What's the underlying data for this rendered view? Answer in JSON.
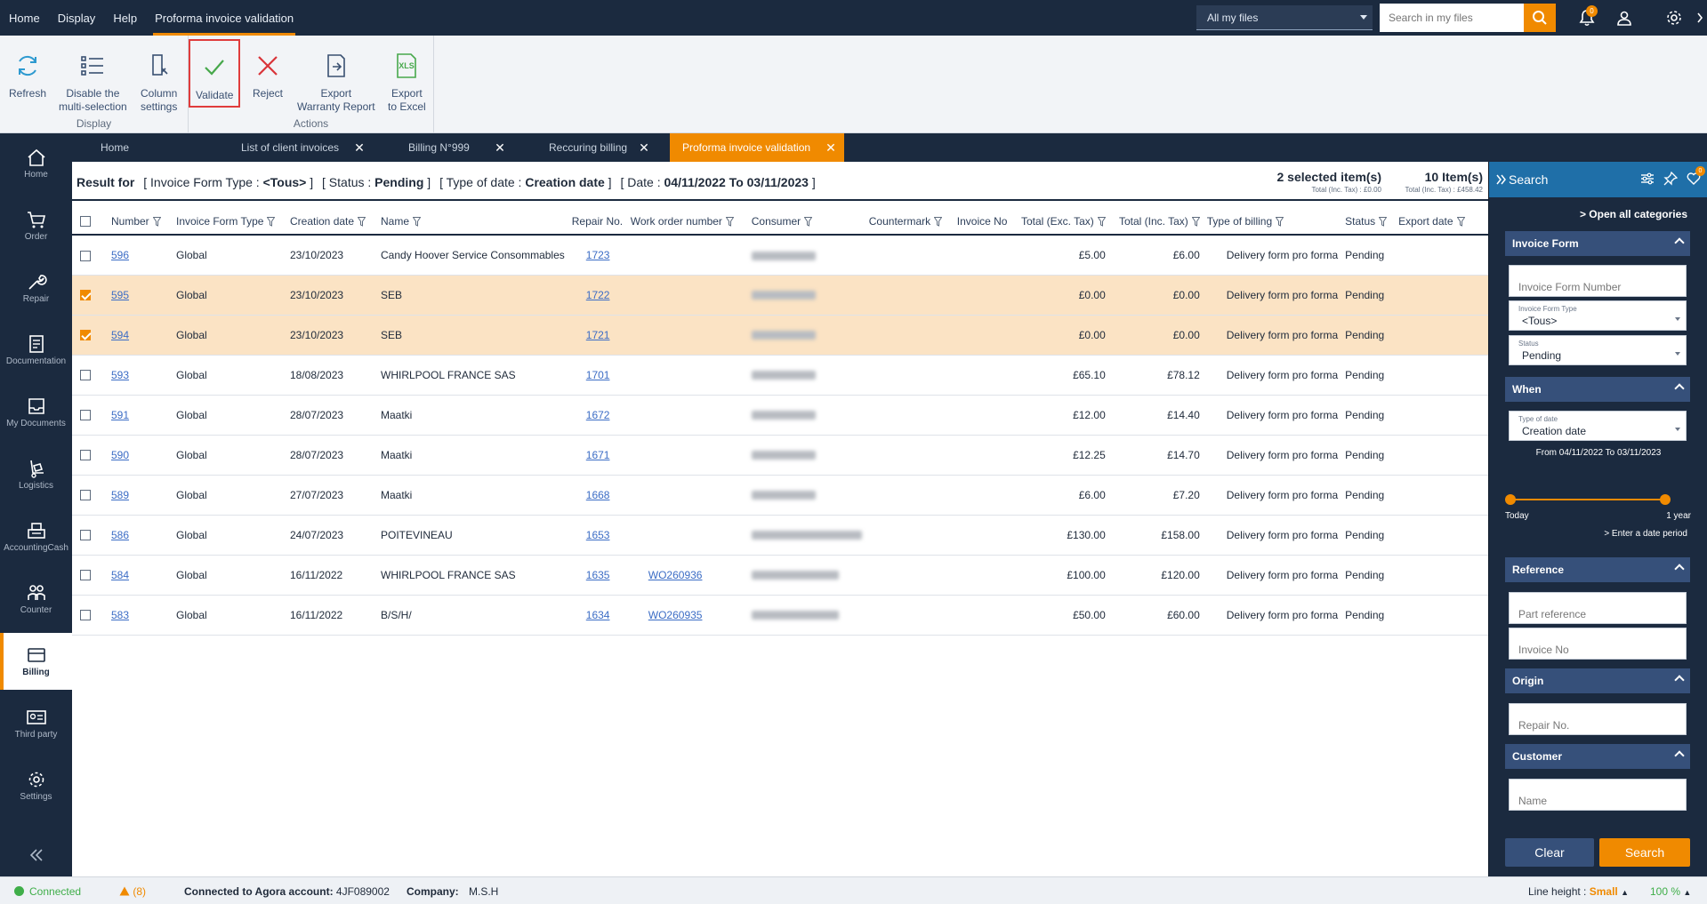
{
  "topbar": {
    "menu": [
      "Home",
      "Display",
      "Help",
      "Proforma invoice validation"
    ],
    "file_scope": "All my files",
    "search_placeholder": "Search in my files",
    "notification_count": "0"
  },
  "ribbon": {
    "display_group": "Display",
    "actions_group": "Actions",
    "refresh": "Refresh",
    "disable_multi_1": "Disable the",
    "disable_multi_2": "multi-selection",
    "column_settings_1": "Column",
    "column_settings_2": "settings",
    "validate": "Validate",
    "reject": "Reject",
    "export_warranty_1": "Export",
    "export_warranty_2": "Warranty Report",
    "export_excel_1": "Export",
    "export_excel_2": "to Excel",
    "xls_label": "XLS"
  },
  "nav": {
    "home": "Home",
    "order": "Order",
    "repair": "Repair",
    "documentation": "Documentation",
    "my_documents": "My Documents",
    "logistics": "Logistics",
    "accounting": "AccountingCash",
    "counter": "Counter",
    "billing": "Billing",
    "third_party": "Third party",
    "settings": "Settings"
  },
  "tabs": [
    "Home",
    "List of client invoices",
    "Billing N°999",
    "Reccuring billing",
    "Proforma invoice validation"
  ],
  "result": {
    "prefix": "Result for",
    "f1_label": "[ Invoice Form Type : ",
    "f1_value": "<Tous>",
    "f1_end": " ]",
    "f2_label": "[ Status : ",
    "f2_value": "Pending",
    "f2_end": " ]",
    "f3_label": "[ Type of date : ",
    "f3_value": "Creation date",
    "f3_end": " ]",
    "f4_label": "[ Date : ",
    "f4_value": "04/11/2022 To 03/11/2023",
    "f4_end": " ]",
    "selected": "2  selected item(s)",
    "selected_sub": "Total (Inc. Tax) : £0.00",
    "items": "10 Item(s)",
    "items_sub": "Total (Inc. Tax) : £458.42"
  },
  "columns": [
    "Number",
    "Invoice Form Type",
    "Creation date",
    "Name",
    "Repair No.",
    "Work order number",
    "Consumer",
    "Countermark",
    "Invoice No",
    "Total (Exc. Tax)",
    "Total (Inc. Tax)",
    "Type of billing",
    "Status",
    "Export date"
  ],
  "rows": [
    {
      "number": "596",
      "type": "Global",
      "date": "23/10/2023",
      "name": "Candy Hoover Service Consommables",
      "repair": "1723",
      "wo": "",
      "excl": "£5.00",
      "incl": "£6.00",
      "billing": "Delivery form pro forma",
      "status": "Pending",
      "selected": false
    },
    {
      "number": "595",
      "type": "Global",
      "date": "23/10/2023",
      "name": "SEB",
      "repair": "1722",
      "wo": "",
      "excl": "£0.00",
      "incl": "£0.00",
      "billing": "Delivery form pro forma",
      "status": "Pending",
      "selected": true
    },
    {
      "number": "594",
      "type": "Global",
      "date": "23/10/2023",
      "name": "SEB",
      "repair": "1721",
      "wo": "",
      "excl": "£0.00",
      "incl": "£0.00",
      "billing": "Delivery form pro forma",
      "status": "Pending",
      "selected": true
    },
    {
      "number": "593",
      "type": "Global",
      "date": "18/08/2023",
      "name": "WHIRLPOOL FRANCE SAS",
      "repair": "1701",
      "wo": "",
      "excl": "£65.10",
      "incl": "£78.12",
      "billing": "Delivery form pro forma",
      "status": "Pending",
      "selected": false
    },
    {
      "number": "591",
      "type": "Global",
      "date": "28/07/2023",
      "name": "Maatki",
      "repair": "1672",
      "wo": "",
      "excl": "£12.00",
      "incl": "£14.40",
      "billing": "Delivery form pro forma",
      "status": "Pending",
      "selected": false
    },
    {
      "number": "590",
      "type": "Global",
      "date": "28/07/2023",
      "name": "Maatki",
      "repair": "1671",
      "wo": "",
      "excl": "£12.25",
      "incl": "£14.70",
      "billing": "Delivery form pro forma",
      "status": "Pending",
      "selected": false
    },
    {
      "number": "589",
      "type": "Global",
      "date": "27/07/2023",
      "name": "Maatki",
      "repair": "1668",
      "wo": "",
      "excl": "£6.00",
      "incl": "£7.20",
      "billing": "Delivery form pro forma",
      "status": "Pending",
      "selected": false
    },
    {
      "number": "586",
      "type": "Global",
      "date": "24/07/2023",
      "name": "POITEVINEAU",
      "repair": "1653",
      "wo": "",
      "excl": "£130.00",
      "incl": "£158.00",
      "billing": "Delivery form pro forma",
      "status": "Pending",
      "selected": false
    },
    {
      "number": "584",
      "type": "Global",
      "date": "16/11/2022",
      "name": "WHIRLPOOL FRANCE SAS",
      "repair": "1635",
      "wo": "WO260936",
      "excl": "£100.00",
      "incl": "£120.00",
      "billing": "Delivery form pro forma",
      "status": "Pending",
      "selected": false
    },
    {
      "number": "583",
      "type": "Global",
      "date": "16/11/2022",
      "name": "B/S/H/",
      "repair": "1634",
      "wo": "WO260935",
      "excl": "£50.00",
      "incl": "£60.00",
      "billing": "Delivery form pro forma",
      "status": "Pending",
      "selected": false
    }
  ],
  "search_panel": {
    "title": "Search",
    "badge": "0",
    "open_all": "Open all categories",
    "invoice_form": "Invoice Form",
    "invoice_form_number": "Invoice Form Number",
    "invoice_form_type_label": "Invoice Form Type",
    "invoice_form_type_value": "<Tous>",
    "status_label": "Status",
    "status_value": "Pending",
    "when": "When",
    "type_of_date_label": "Type of date",
    "type_of_date_value": "Creation date",
    "range": "From 04/11/2022 To 03/11/2023",
    "today": "Today",
    "one_year": "1 year",
    "enter_period": "> Enter a date period",
    "reference": "Reference",
    "part_reference": "Part reference",
    "invoice_no": "Invoice No",
    "origin": "Origin",
    "repair_no": "Repair No.",
    "customer": "Customer",
    "name": "Name",
    "clear": "Clear",
    "search": "Search"
  },
  "statusbar": {
    "connected": "Connected",
    "warnings": "(8)",
    "agora_label": "Connected to Agora account:",
    "agora_value": "4JF089002",
    "company_label": "Company:",
    "company_value": "M.S.H",
    "line_height_label": "Line height :",
    "line_height_value": "Small",
    "zoom": "100 %"
  },
  "colors": {
    "navy": "#1b2a3f",
    "accent": "#f08a00",
    "selected_row": "#fbe3c4",
    "link": "#3b6cc5",
    "search_header": "#1f6fa8"
  }
}
